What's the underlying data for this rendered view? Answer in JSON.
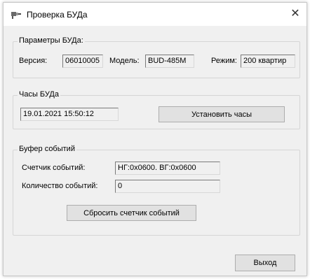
{
  "window": {
    "title": "Проверка БУДа"
  },
  "params": {
    "legend": "Параметры БУДа:",
    "version_label": "Версия:",
    "version_value": "06010005",
    "model_label": "Модель:",
    "model_value": "BUD-485M",
    "mode_label": "Режим:",
    "mode_value": "200 квартир"
  },
  "clock": {
    "legend": "Часы БУДа",
    "datetime_value": "19.01.2021 15:50:12",
    "set_button": "Установить часы"
  },
  "events": {
    "legend": "Буфер событий",
    "counter_label": "Счетчик событий:",
    "counter_value": "НГ:0x0600.  ВГ:0x0600",
    "count_label": "Количество событий:",
    "count_value": "0",
    "reset_button": "Сбросить счетчик событий"
  },
  "footer": {
    "exit_button": "Выход"
  },
  "icons": {
    "app": "usb-plug-icon",
    "close": "close-icon"
  }
}
